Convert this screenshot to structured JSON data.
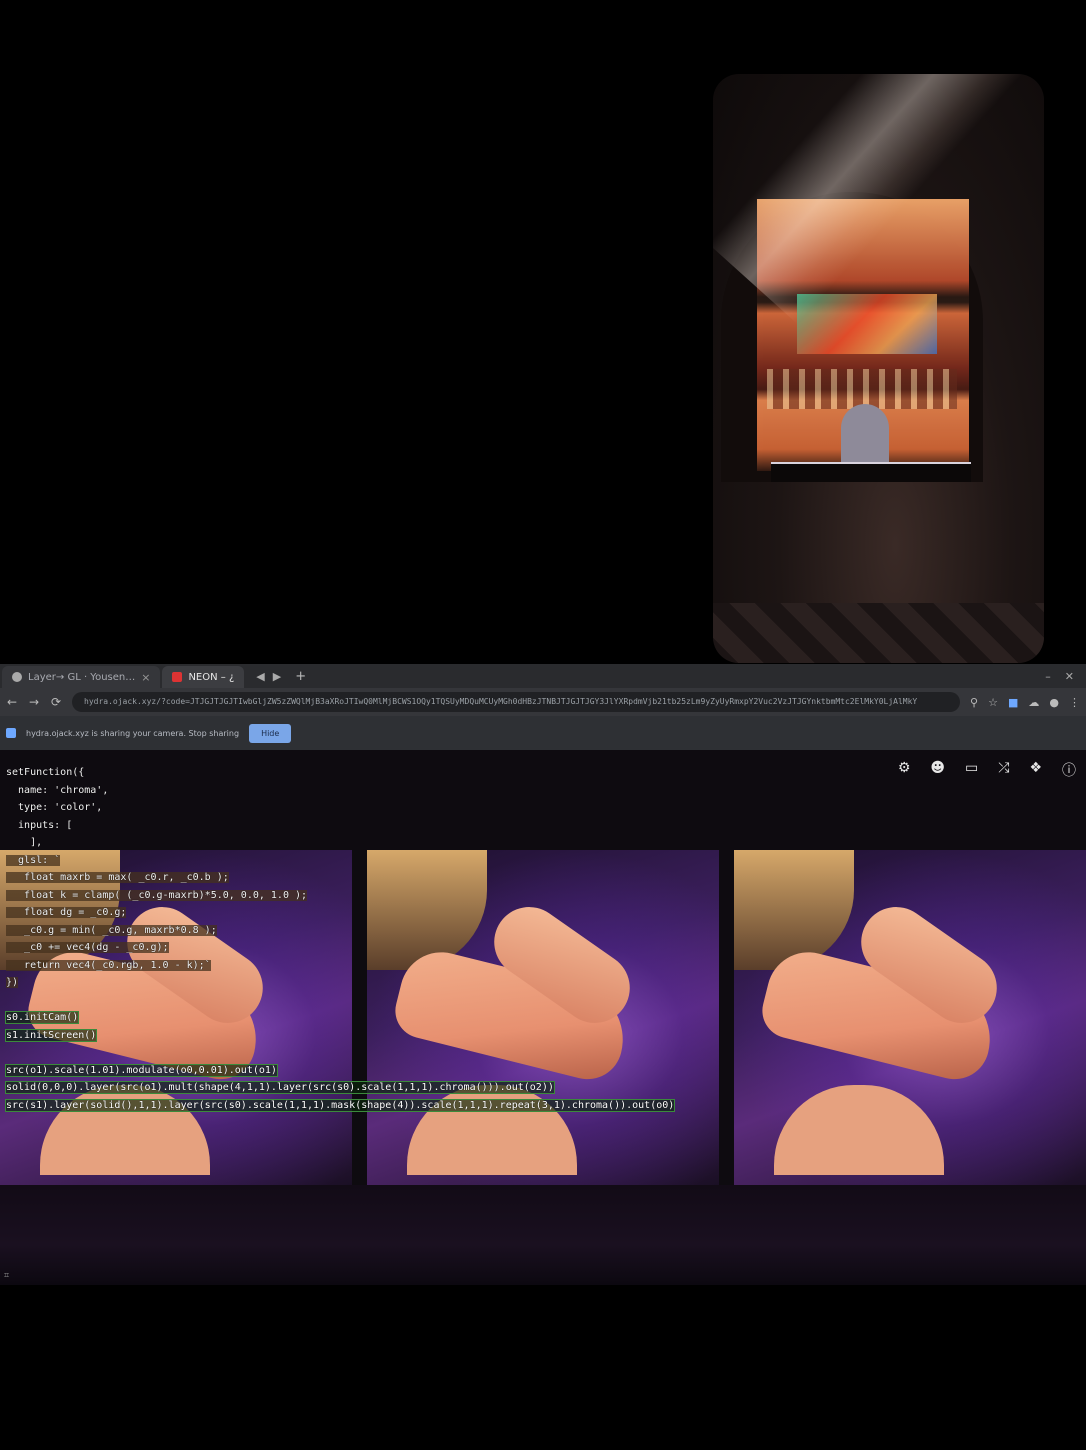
{
  "browser": {
    "tabs": [
      {
        "label": "Layer→ GL · Yousen…",
        "icon": "globe-icon",
        "close": "×"
      },
      {
        "label": "NEON – ¿",
        "icon": "app-favicon",
        "close": ""
      }
    ],
    "nav_arrows": [
      "◀",
      "▶"
    ],
    "new_tab": "+",
    "window_controls": [
      "–",
      "✕"
    ],
    "nav": {
      "back": "←",
      "forward": "→",
      "reload": "⟳",
      "lock": "🔒"
    },
    "url": "hydra.ojack.xyz/?code=JTJGJTJGJTIwbGljZW5zZWQlMjB3aXRoJTIwQ0MlMjBCWS1OQy1TQSUyMDQuMCUyMGh0dHBzJTNBJTJGJTJGY3JlYXRpdmVjb21tb25zLm9yZyUyRmxpY2Vuc2VzJTJGYnktbmMtc2ElMkY0LjAlMkY",
    "toolbar_icons": [
      "key-icon",
      "star-icon",
      "extension-icon",
      "cloud-icon",
      "profile-icon",
      "menu-icon"
    ],
    "infobar": {
      "text": "hydra.ojack.xyz is sharing your camera. Stop sharing",
      "button": "Hide"
    }
  },
  "hydra": {
    "top_icons": [
      "gear-icon",
      "person-icon",
      "trash-icon",
      "shuffle-icon",
      "layers-icon",
      "help-icon"
    ],
    "code_lines": [
      "setFunction({",
      "  name: 'chroma',",
      "  type: 'color',",
      "  inputs: [",
      "    ],",
      "  glsl: `",
      "   float maxrb = max( _c0.r, _c0.b );",
      "   float k = clamp( (_c0.g-maxrb)*5.0, 0.0, 1.0 );",
      "   float dg = _c0.g;",
      "   _c0.g = min( _c0.g, maxrb*0.8 );",
      "   _c0 += vec4(dg - _c0.g);",
      "   return vec4(_c0.rgb, 1.0 - k);`",
      "})",
      "",
      "s0.initCam()",
      "s1.initScreen()",
      "",
      "src(o1).scale(1.01).modulate(o0,0.01).out(o1)",
      "solid(0,0,0).layer(src(o1).mult(shape(4,1,1).layer(src(s0).scale(1,1,1).chroma())).out(o2))",
      "src(s1).layer(solid(),1,1).layer(src(s0).scale(1,1,1).mask(shape(4)).scale(1,1,1).repeat(3,1).chroma()).out(o0)"
    ],
    "corner_glyph": "⌗"
  },
  "colors": {
    "background": "#000000",
    "browser_chrome": "#35363a",
    "accent": "#7aa6e8"
  }
}
